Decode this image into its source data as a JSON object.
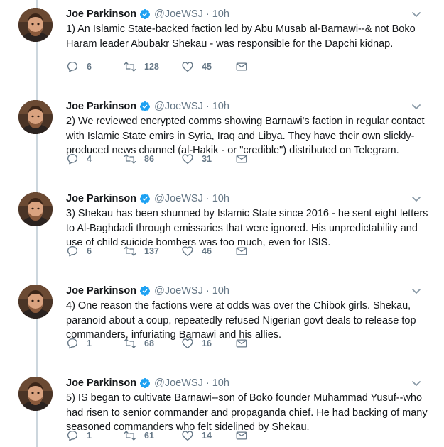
{
  "colors": {
    "accent": "#1da1f2",
    "icon_gray": "#657786",
    "text": "#14171a",
    "thread_line": "#ccd6dd"
  },
  "author": {
    "name": "Joe Parkinson",
    "handle": "@JoeWSJ",
    "separator": "·",
    "time": "10h"
  },
  "tweets": [
    {
      "text": "1) An Islamic State-backed faction led by Abu Musab al-Barnawi--& not Boko\nHaram leader Abubakr Shekau - was responsible for the Dapchi kidnap.",
      "replies": "6",
      "retweets": "128",
      "likes": "45"
    },
    {
      "text": "2) We reviewed encrypted comms showing Barnawi's faction in regular contact\nwith Islamic State emirs in Syria, Iraq and Libya. They have their own slickly-\nproduced news channel (al-Hakik - or \"credible\") distributed on Telegram.",
      "replies": "4",
      "retweets": "86",
      "likes": "31"
    },
    {
      "text": "3) Shekau has been shunned by Islamic State since 2016 - he sent eight letters\nto Al-Baghdadi through emissaries that were ignored. His unpredictability and\nuse of child suicide bombers was too much, even for ISIS.",
      "replies": "6",
      "retweets": "137",
      "likes": "46"
    },
    {
      "text": "4) One reason the factions were at odds was over the Chibok girls. Shekau,\nparanoid about a coup, repeatedly refused Nigerian govt deals to release top\ncommanders, infuriating Barnawi and his allies.",
      "replies": "1",
      "retweets": "68",
      "likes": "16"
    },
    {
      "text": "5) IS began to cultivate Barnawi--son of Boko founder Muhammad Yusuf--who\nhad risen to senior commander and propaganda chief. He had backing of many\nseasoned commanders who felt sidelined by Shekau.",
      "replies": "1",
      "retweets": "61",
      "likes": "14"
    }
  ]
}
